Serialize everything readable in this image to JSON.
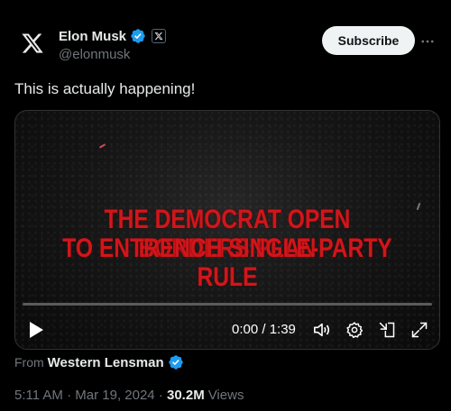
{
  "author": {
    "display_name": "Elon Musk",
    "handle": "@elonmusk",
    "verified_color": "#1d9bf0",
    "avatar_icon": "x-logo-icon",
    "affiliate_badge_icon": "x-affiliate-badge-icon"
  },
  "actions": {
    "subscribe_label": "Subscribe",
    "more_icon": "more-dots-icon"
  },
  "tweet": {
    "text": "This is actually happening!"
  },
  "video": {
    "headline_line1": "THE DEMOCRAT OPEN BORDERS PLAN",
    "headline_line2": "TO ENTRENCH SINGLE-PARTY RULE",
    "headline_color": "#d1161b",
    "time_display": "0:00 / 1:39",
    "progress_fraction": 0.0,
    "controls": [
      "play-icon",
      "volume-icon",
      "settings-icon",
      "pip-icon",
      "fullscreen-icon"
    ]
  },
  "source": {
    "prefix": "From",
    "name": "Western Lensman"
  },
  "meta": {
    "time": "5:11 AM",
    "sep1": " · ",
    "date": "Mar 19, 2024",
    "sep2": " · ",
    "views_count": "30.2M",
    "views_label": "Views"
  }
}
